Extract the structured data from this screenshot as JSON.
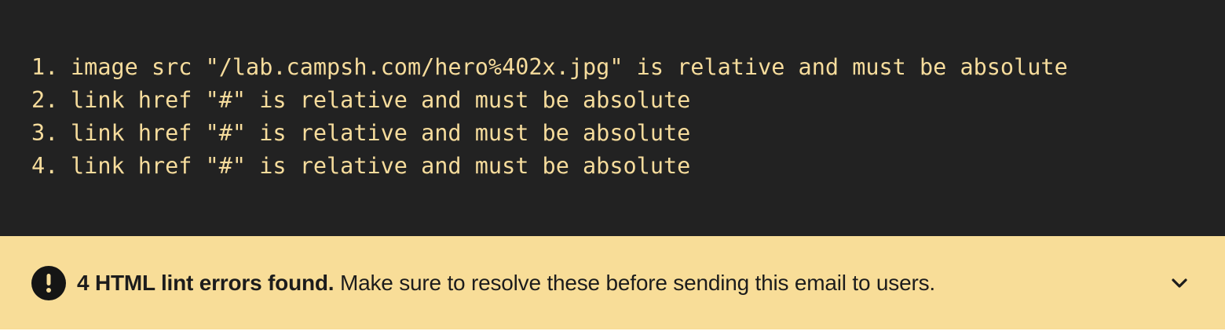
{
  "errors": [
    {
      "number": "1.",
      "message": "image src \"/lab.campsh.com/hero%402x.jpg\" is relative and must be absolute"
    },
    {
      "number": "2.",
      "message": "link href \"#\" is relative and must be absolute"
    },
    {
      "number": "3.",
      "message": "link href \"#\" is relative and must be absolute"
    },
    {
      "number": "4.",
      "message": "link href \"#\" is relative and must be absolute"
    }
  ],
  "banner": {
    "summary": "4 HTML lint errors found.",
    "detail": " Make sure to resolve these before sending this email to users.",
    "icon": "exclamation-circle-icon",
    "toggle_icon": "chevron-down-icon"
  },
  "colors": {
    "list_background": "#222222",
    "list_text": "#f6dc9c",
    "banner_background": "#f8dd98",
    "banner_text": "#1c1c1c"
  }
}
